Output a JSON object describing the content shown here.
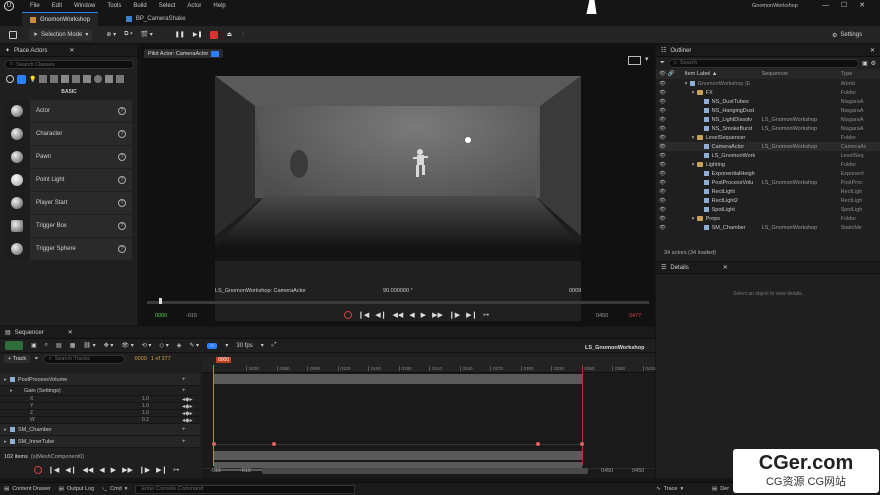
{
  "menu": [
    "File",
    "Edit",
    "Window",
    "Tools",
    "Build",
    "Select",
    "Actor",
    "Help"
  ],
  "window_title": "GnomonWorkshop",
  "tabs": [
    {
      "label": "GnomonWorkshop",
      "active": true
    },
    {
      "label": "BP_CameraShake",
      "active": false
    }
  ],
  "toolbar": {
    "selection_mode": "Selection Mode",
    "settings": "Settings"
  },
  "place_actors": {
    "title": "Place Actors",
    "search_placeholder": "Search Classes",
    "category": "BASIC",
    "items": [
      "Actor",
      "Character",
      "Pawn",
      "Point Light",
      "Player Start",
      "Trigger Box",
      "Trigger Sphere"
    ]
  },
  "viewport": {
    "pilot_label": "Pilot Actor: CameraActor",
    "overlay_left": "LS_GnomonWorkshop: CameraActor",
    "overlay_center": "90.000000 °",
    "overlay_right": "0009",
    "time_start": "0000",
    "time_start2": "-015",
    "time_end": "0450",
    "time_end2": "0477"
  },
  "outliner": {
    "title": "Outliner",
    "search_placeholder": "Search",
    "col_label": "Item Label ▲",
    "col_seq": "Sequencer",
    "col_type": "Type",
    "rows": [
      {
        "indent": 0,
        "kind": "world",
        "label": "GnomonWorkshop (E",
        "seq": "",
        "type": "World",
        "dim": true
      },
      {
        "indent": 1,
        "kind": "folder",
        "label": "FX",
        "seq": "",
        "type": "Folder"
      },
      {
        "indent": 2,
        "kind": "obj",
        "label": "NS_DustTubes",
        "seq": "",
        "type": "NiagaraA"
      },
      {
        "indent": 2,
        "kind": "obj",
        "label": "NS_HangingDust",
        "seq": "",
        "type": "NiagaraA"
      },
      {
        "indent": 2,
        "kind": "obj",
        "label": "NS_LightDissolv",
        "seq": "LS_GnomonWorkshop",
        "type": "NiagaraA"
      },
      {
        "indent": 2,
        "kind": "obj",
        "label": "NS_SmokeBurst",
        "seq": "LS_GnomonWorkshop",
        "type": "NiagaraA"
      },
      {
        "indent": 1,
        "kind": "folder",
        "label": "LevelSequencer",
        "seq": "",
        "type": "Folder"
      },
      {
        "indent": 2,
        "kind": "obj",
        "label": "CameraActor",
        "seq": "LS_GnomonWorkshop",
        "type": "CameraAc"
      },
      {
        "indent": 2,
        "kind": "obj",
        "label": "LS_GnomonWork",
        "seq": "",
        "type": "LevelSeq"
      },
      {
        "indent": 1,
        "kind": "folder",
        "label": "Lighting",
        "seq": "",
        "type": "Folder"
      },
      {
        "indent": 2,
        "kind": "obj",
        "label": "ExponentialHeigh",
        "seq": "",
        "type": "Exponent"
      },
      {
        "indent": 2,
        "kind": "obj",
        "label": "PostProcessVolu",
        "seq": "LS_GnomonWorkshop",
        "type": "PostProc"
      },
      {
        "indent": 2,
        "kind": "obj",
        "label": "RectLight",
        "seq": "",
        "type": "RectLigh"
      },
      {
        "indent": 2,
        "kind": "obj",
        "label": "RectLight2",
        "seq": "",
        "type": "RectLigh"
      },
      {
        "indent": 2,
        "kind": "obj",
        "label": "SpotLight",
        "seq": "",
        "type": "SpotLigh"
      },
      {
        "indent": 1,
        "kind": "folder",
        "label": "Props",
        "seq": "",
        "type": "Folder"
      },
      {
        "indent": 2,
        "kind": "obj",
        "label": "SM_Chamber",
        "seq": "LS_GnomonWorkshop",
        "type": "StaticMe"
      }
    ],
    "footer": "34 actors (34 loaded)"
  },
  "details": {
    "title": "Details",
    "empty": "Select an object to view details."
  },
  "sequencer": {
    "title": "Sequencer",
    "fps": "30 fps",
    "seq_name": "LS_GnomonWorkshop",
    "add_track": "+ Track",
    "search_placeholder": "Search Tracks",
    "frame": "0000",
    "frame_of": "1 of 377",
    "playhead": "0000",
    "ruler": [
      "0030",
      "0060",
      "0090",
      "0120",
      "0150",
      "0180",
      "0210",
      "0240",
      "0270",
      "0300",
      "0330",
      "0360",
      "0390",
      "0420"
    ],
    "tracks": [
      {
        "label": "PostProcessVolume",
        "indent": 0,
        "kind": "actor",
        "value": ""
      },
      {
        "label": "Gain (Settings)",
        "indent": 1,
        "kind": "group",
        "value": ""
      },
      {
        "label": "X",
        "indent": 2,
        "kind": "channel",
        "value": "1.0"
      },
      {
        "label": "Y",
        "indent": 2,
        "kind": "channel",
        "value": "1.0"
      },
      {
        "label": "Z",
        "indent": 2,
        "kind": "channel",
        "value": "1.0"
      },
      {
        "label": "W",
        "indent": 2,
        "kind": "channel",
        "value": "0.2"
      },
      {
        "label": "SM_Chamber",
        "indent": 0,
        "kind": "actor",
        "value": ""
      },
      {
        "label": "SM_InnerTube",
        "indent": 0,
        "kind": "actor",
        "value": ""
      }
    ],
    "items_count": "102 items",
    "items_selected": "(s(MeshComponent0)",
    "range_left": "-015",
    "range_left2": "-015",
    "range_right": "0450",
    "range_right2": "0450"
  },
  "statusbar": {
    "content_drawer": "Content Drawer",
    "output_log": "Output Log",
    "cmd": "Cmd",
    "console_placeholder": "Enter Console Command",
    "trace": "Trace",
    "derived": "Der"
  },
  "watermark": {
    "main": "CGer.com",
    "sub": "CG资源 CG网站"
  }
}
